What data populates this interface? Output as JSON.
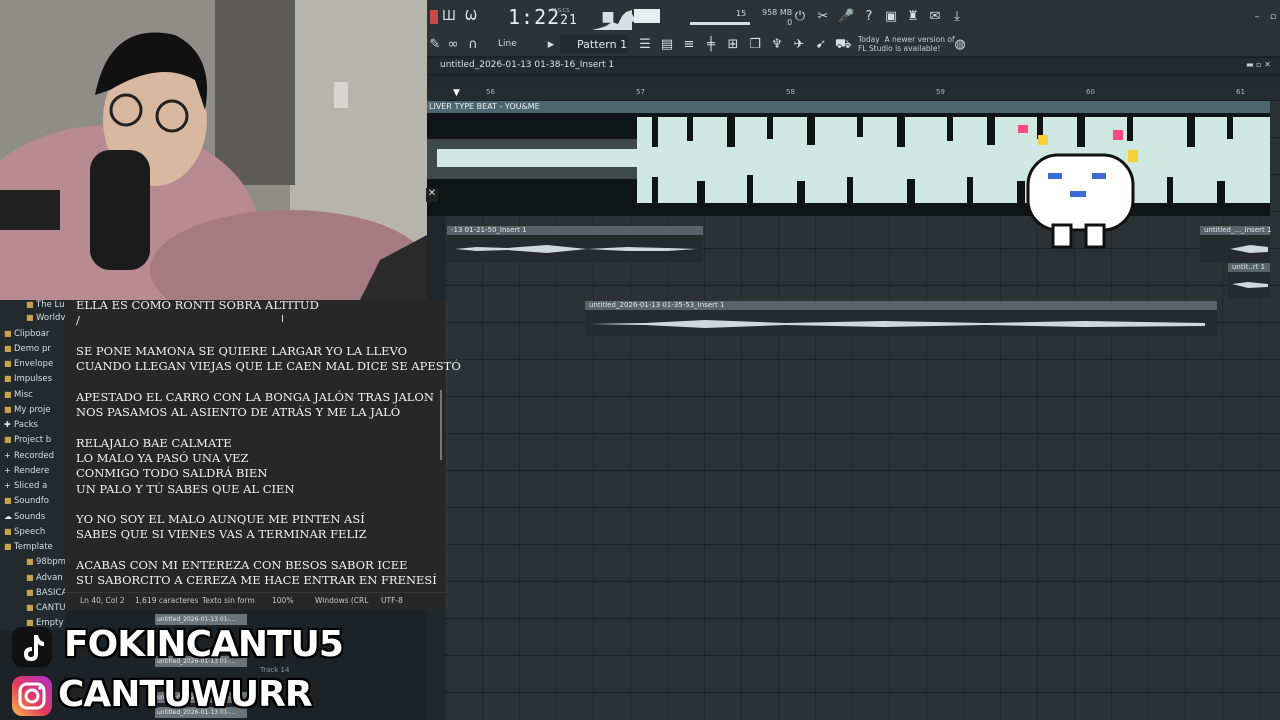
{
  "toolbar": {
    "clock": "1:22",
    "clock_small": "21",
    "clock_unit": "M:S:CS",
    "tempo_pattern": "15",
    "memory_top": "958 MB",
    "memory_bottom": "0",
    "snap_mode": "Line",
    "pattern_name": "Pattern 1",
    "update_today": "Today",
    "update_line1": "A newer version of",
    "update_line2": "FL Studio is available!"
  },
  "playlist": {
    "title": "untitled_2026-01-13 01-38-16_Insert 1",
    "bars": [
      "56",
      "57",
      "58",
      "59",
      "60",
      "61"
    ],
    "clip_main_label": "LIVER TYPE BEAT - YOU&ME",
    "clips": [
      {
        "label": "-13 01-21-50_Insert 1"
      },
      {
        "label": "untitled_..._Insert 1"
      },
      {
        "label": "untit..rt 1"
      },
      {
        "label": "untitled_2026-01-13 01-35-53_Insert 1"
      }
    ]
  },
  "browser": {
    "items": [
      {
        "label": "The Lu",
        "icon": "folder-icon"
      },
      {
        "label": "Worldv",
        "icon": "folder-icon"
      },
      {
        "label": "Clipboar",
        "icon": "folder-icon"
      },
      {
        "label": "Demo pr",
        "icon": "folder-icon"
      },
      {
        "label": "Envelope",
        "icon": "folder-icon"
      },
      {
        "label": "Impulses",
        "icon": "folder-icon"
      },
      {
        "label": "Misc",
        "icon": "folder-icon"
      },
      {
        "label": "My proje",
        "icon": "folder-icon"
      },
      {
        "label": "Packs",
        "icon": "packs-icon"
      },
      {
        "label": "Project b",
        "icon": "folder-icon"
      },
      {
        "label": "Recorded",
        "icon": "plus-icon"
      },
      {
        "label": "Rendere",
        "icon": "plus-icon"
      },
      {
        "label": "Sliced a",
        "icon": "plus-icon"
      },
      {
        "label": "Soundfo",
        "icon": "folder-icon"
      },
      {
        "label": "Sounds",
        "icon": "cloud-icon"
      },
      {
        "label": "Speech",
        "icon": "folder-icon"
      },
      {
        "label": "Template",
        "icon": "folder-icon"
      },
      {
        "label": "98bpm",
        "icon": "folder-icon"
      },
      {
        "label": "Advan",
        "icon": "folder-icon"
      },
      {
        "label": "BASICA",
        "icon": "folder-icon"
      },
      {
        "label": "CANTU",
        "icon": "folder-icon"
      },
      {
        "label": "Empty",
        "icon": "folder-icon"
      }
    ]
  },
  "notepad": {
    "text": "ELLA ES COMO RONTI SOBRA ALTITUD\n/\n\nSE PONE MAMONA SE QUIERE LARGAR YO LA LLEVO\nCUANDO LLEGAN VIEJAS QUE LE CAEN MAL DICE SE APESTÓ\n\nAPESTADO EL CARRO CON LA BONGA JALÓN TRAS JALON\nNOS PASAMOS AL ASIENTO DE ATRÁS Y ME LA JALÓ\n\nRELAJALO BAE CALMATE\nLO MALO YA PASÓ UNA VEZ\nCONMIGO TODO SALDRÁ BIEN\nUN PALO Y TÚ SABES QUE AL CIEN\n\nYO NO SOY EL MALO AUNQUE ME PINTEN ASÍ\nSABES QUE SI VIENES VAS A TERMINAR FELIZ\n\nACABAS CON MI ENTEREZA CON BESOS SABOR ICEE\nSU SABORCITO A CEREZA ME HACE ENTRAR EN FRENESÍ",
    "status": {
      "position": "Ln 40, Col 2",
      "chars": "1,619 caracteres",
      "format": "Texto sin form",
      "zoom": "100%",
      "eol": "Windows (CRL",
      "encoding": "UTF-8"
    }
  },
  "under_clips": [
    "untitled_2026-01-13 01-...",
    "untitled_2026-01-13 01-...",
    "untitled_2026-01-13 01-...",
    "untitled_2026-01-13 01-..."
  ],
  "track_label": "Track 14",
  "social": {
    "tiktok": "FOKINCANTU5",
    "instagram": "CANTUWURR"
  },
  "colors": {
    "waveform": "#cfe8e2",
    "clip_header": "#4c6670",
    "tiktok_bg": "#111111",
    "instagram_bg": "#d6249f"
  }
}
